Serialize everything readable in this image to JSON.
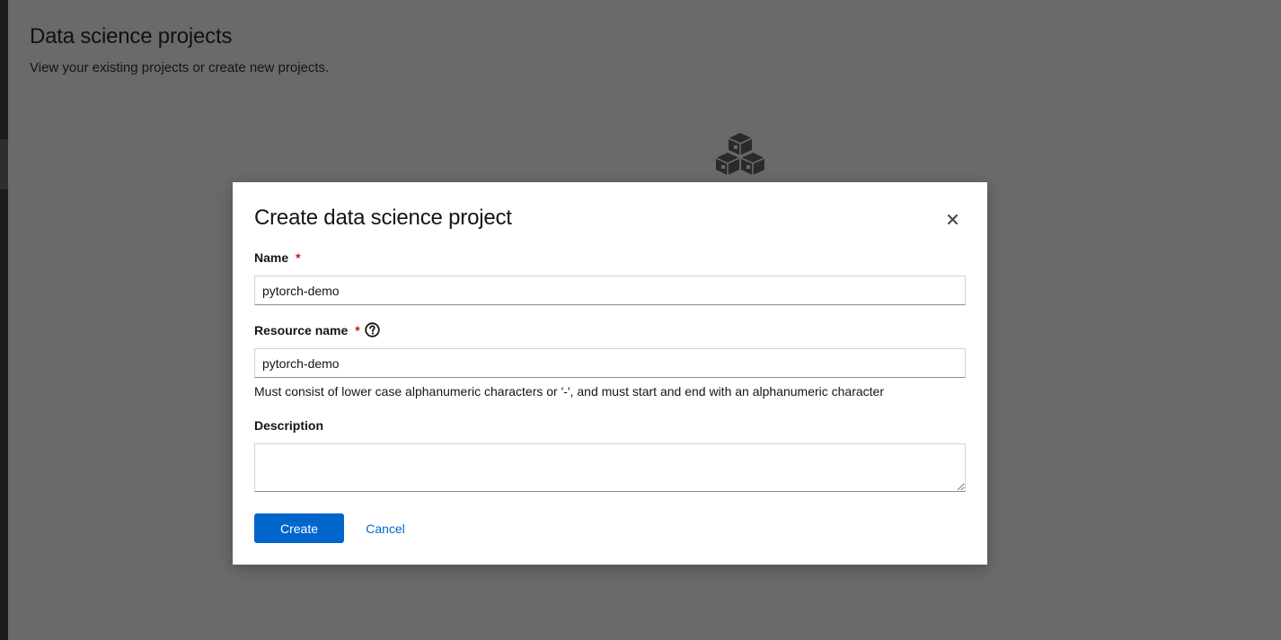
{
  "page": {
    "title": "Data science projects",
    "subtitle": "View your existing projects or create new projects.",
    "empty_state_icon": "cubes-icon"
  },
  "modal": {
    "title": "Create data science project",
    "close_icon": "close-icon",
    "name": {
      "label": "Name",
      "required_marker": "*",
      "value": "pytorch-demo"
    },
    "resource_name": {
      "label": "Resource name",
      "required_marker": "*",
      "help_icon": "question-circle-icon",
      "value": "pytorch-demo",
      "helper_text": "Must consist of lower case alphanumeric characters or '-', and must start and end with an alphanumeric character"
    },
    "description": {
      "label": "Description",
      "value": ""
    },
    "create_label": "Create",
    "cancel_label": "Cancel"
  },
  "colors": {
    "primary": "#0066cc",
    "required": "#c9190b",
    "backdrop": "#6a6a6a"
  }
}
